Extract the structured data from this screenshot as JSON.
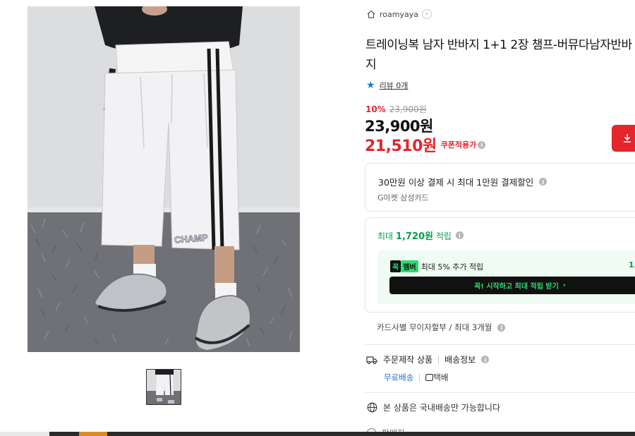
{
  "seller": {
    "name": "roamyaya",
    "home_icon": "home-icon",
    "chevron_icon": "chevron-right-icon"
  },
  "product": {
    "title": "트레이닝복 남자 반바지 1+1 2장 챔프-버뮤다남자반바지",
    "review_label": "리뷰 0개",
    "discount_percent": "10%",
    "original_price": "23,900원",
    "price": "23,900원",
    "coupon_price": "21,510원",
    "coupon_label": "쿠폰적용가",
    "print_text": "CHAMP"
  },
  "card_offer": {
    "title": "30만원 이상 결제 시 최대 1만원 결제할인",
    "card": "G마켓 삼성카드"
  },
  "points": {
    "prefix": "최대 ",
    "amount": "1,720원",
    "suffix": " 적립",
    "member_badge_a": "꼭",
    "member_badge_b": "멤버",
    "member_text": "최대 5% 추가 적립",
    "member_amount": "1,",
    "cta_label": "꼭! 시작하고 최대 적립 받기",
    "cta_arrow": "›"
  },
  "installment": "카드사별 무이자할부 / 최대 3개월",
  "shipping": {
    "label": "주문제작 상품",
    "info_label": "배송정보",
    "free": "무료배송",
    "courier": "택배"
  },
  "domestic": "본 상품은 국내배송만 가능합니다",
  "partial_label": "판매자",
  "colors": {
    "red": "#e5242b",
    "green": "#0a9d4b",
    "blue": "#1f6fd1",
    "member_green": "#2bdc6d"
  }
}
